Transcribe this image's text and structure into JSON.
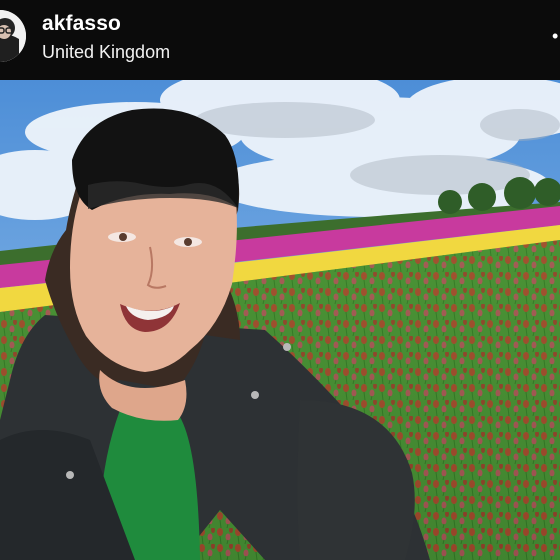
{
  "post": {
    "username": "akfasso",
    "location": "United Kingdom",
    "more_icon": "more-dots-icon",
    "avatar_icon": "avatar-icon"
  },
  "photo": {
    "subject": "selfie-photo"
  },
  "colors": {
    "header_bg": "#0b0b0b",
    "text": "#ffffff",
    "sky": "#5f97d8",
    "tulip_pink": "#d0339a",
    "tulip_yellow": "#f1d840",
    "tulip_red": "#c8202a",
    "foliage": "#3f8b2f"
  }
}
